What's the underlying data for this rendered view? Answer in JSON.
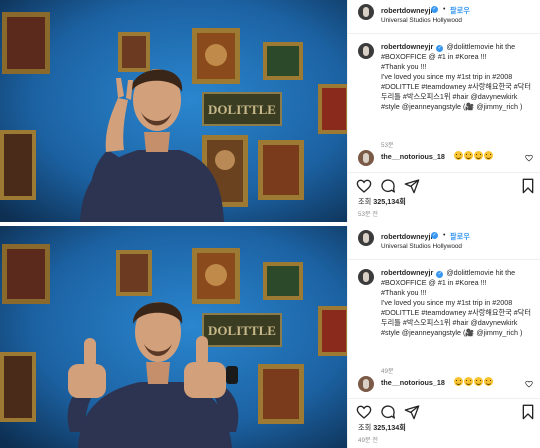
{
  "posts": [
    {
      "author": {
        "username": "robertdowneyjr",
        "follow_label": "팔로우",
        "location": "Universal Studios Hollywood"
      },
      "caption": {
        "username": "robertdowneyjr",
        "lines": [
          "@dolittlemovie hit the #BOXOFFICE @ #1 in #Korea !!!",
          "#Thank you !!!",
          "I've loved you since my #1st trip in #2008 #DOLITTLE #teamdowney #사랑해요한국 #닥터두리틀 #박스오피스1위 #hair @davynewkirk #style @jeanneyangstyle (🎥 @jimmy_rich )"
        ],
        "time": "53분"
      },
      "comment": {
        "username": "the__notorious_18"
      },
      "media": {
        "sign_text": "DOLITTLE"
      },
      "likes": {
        "prefix": "조회",
        "count": "325,134회"
      },
      "posted": "53분 전"
    },
    {
      "author": {
        "username": "robertdowneyjr",
        "follow_label": "팔로우",
        "location": "Universal Studios Hollywood"
      },
      "caption": {
        "username": "robertdowneyjr",
        "lines": [
          "@dolittlemovie hit the #BOXOFFICE @ #1 in #Korea !!!",
          "#Thank you !!!",
          "I've loved you since my #1st trip in #2008 #DOLITTLE #teamdowney #사랑해요한국 #닥터두리틀 #박스오피스1위 #hair @davynewkirk #style @jeanneyangstyle (🎥 @jimmy_rich )"
        ],
        "time": "49분"
      },
      "comment": {
        "username": "the__notorious_18"
      },
      "media": {
        "sign_text": "DOLITTLE"
      },
      "likes": {
        "prefix": "조회",
        "count": "325,134회"
      },
      "posted": "49분 전"
    }
  ],
  "icons": [
    "heart-icon",
    "comment-icon",
    "share-icon",
    "bookmark-icon",
    "verified-badge-icon",
    "more-options-icon"
  ],
  "colors": {
    "wall": "#1f6fb3",
    "link": "#3897f0",
    "text": "#262626",
    "muted": "#8e8e8e",
    "sign": "#3a3d22",
    "sign_text": "#c9b98a"
  }
}
